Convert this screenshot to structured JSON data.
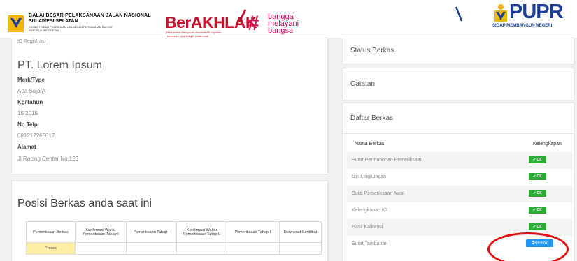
{
  "header": {
    "org_name_line1": "BALAI BESAR PELAKSANAAN JALAN NASIONAL",
    "org_name_line2": "SULAWESI SELATAN",
    "org_ministry": "KEMENTERIAN PEKERJAAN UMUM DAN PERUMAHAN RAKYAT",
    "org_country": "REPUBLIK INDONESIA",
    "berakhlak": "BerAKHLAK",
    "berakhlak_sub1": "Berorientasi Pelayanan Akuntabel Kompeten",
    "berakhlak_sub2": "Harmonis Loyal Adaptif Kolaboratif",
    "bangga_hash": "#",
    "bangga_line1": "bangga",
    "bangga_line2": "melayani",
    "bangga_line3": "bangsa",
    "pupr": "PUPR",
    "pupr_tagline": "SIGAP MEMBANGUN NEGERI"
  },
  "info": {
    "ghost_label": "ID Registrasi",
    "company": "PT. Lorem Ipsum",
    "fields": [
      {
        "label": "Merk/Type",
        "value": "Apa Saja/A"
      },
      {
        "label": "Kg/Tahun",
        "value": "15/2015"
      },
      {
        "label": "No Telp",
        "value": "081217265017"
      },
      {
        "label": "Alamat",
        "value": "Jl.Racing Center No.123"
      }
    ]
  },
  "posisi": {
    "title": "Posisi Berkas anda saat ini",
    "columns": [
      "Pemeriksaan Berkas",
      "Konfirmasi Waktu Pemeriksaan Tahap I",
      "Pemeriksaan Tahap I",
      "Konfirmasi Waktu Pemeriksaan Tahap II",
      "Pemeriksaan Tahap II",
      "Download Sertifikat"
    ],
    "row": [
      "Proses",
      "",
      "",
      "",
      "",
      ""
    ]
  },
  "panels": {
    "status": "Status Berkas",
    "catatan": "Catatan",
    "daftar": "Daftar Berkas"
  },
  "daftar": {
    "col_name": "Nama Berkas",
    "col_status": "Kelengkapan",
    "ok_label": "✔ OK",
    "review_label": "Review",
    "items": [
      {
        "name": "Surat Permohonan Pemeriksaan",
        "status": "ok"
      },
      {
        "name": "Izin Lingkungan",
        "status": "ok"
      },
      {
        "name": "Bukti Pemeriksaan Awal",
        "status": "ok"
      },
      {
        "name": "Kelengkapan K3",
        "status": "ok"
      },
      {
        "name": "Hasil Kalibrasi",
        "status": "ok"
      },
      {
        "name": "Surat Tambahan",
        "status": "review"
      }
    ]
  },
  "colors": {
    "ok_green": "#2eaa36",
    "review_blue": "#2196f3",
    "highlight_red": "#e01010",
    "proses_yellow": "#fbeda2"
  }
}
